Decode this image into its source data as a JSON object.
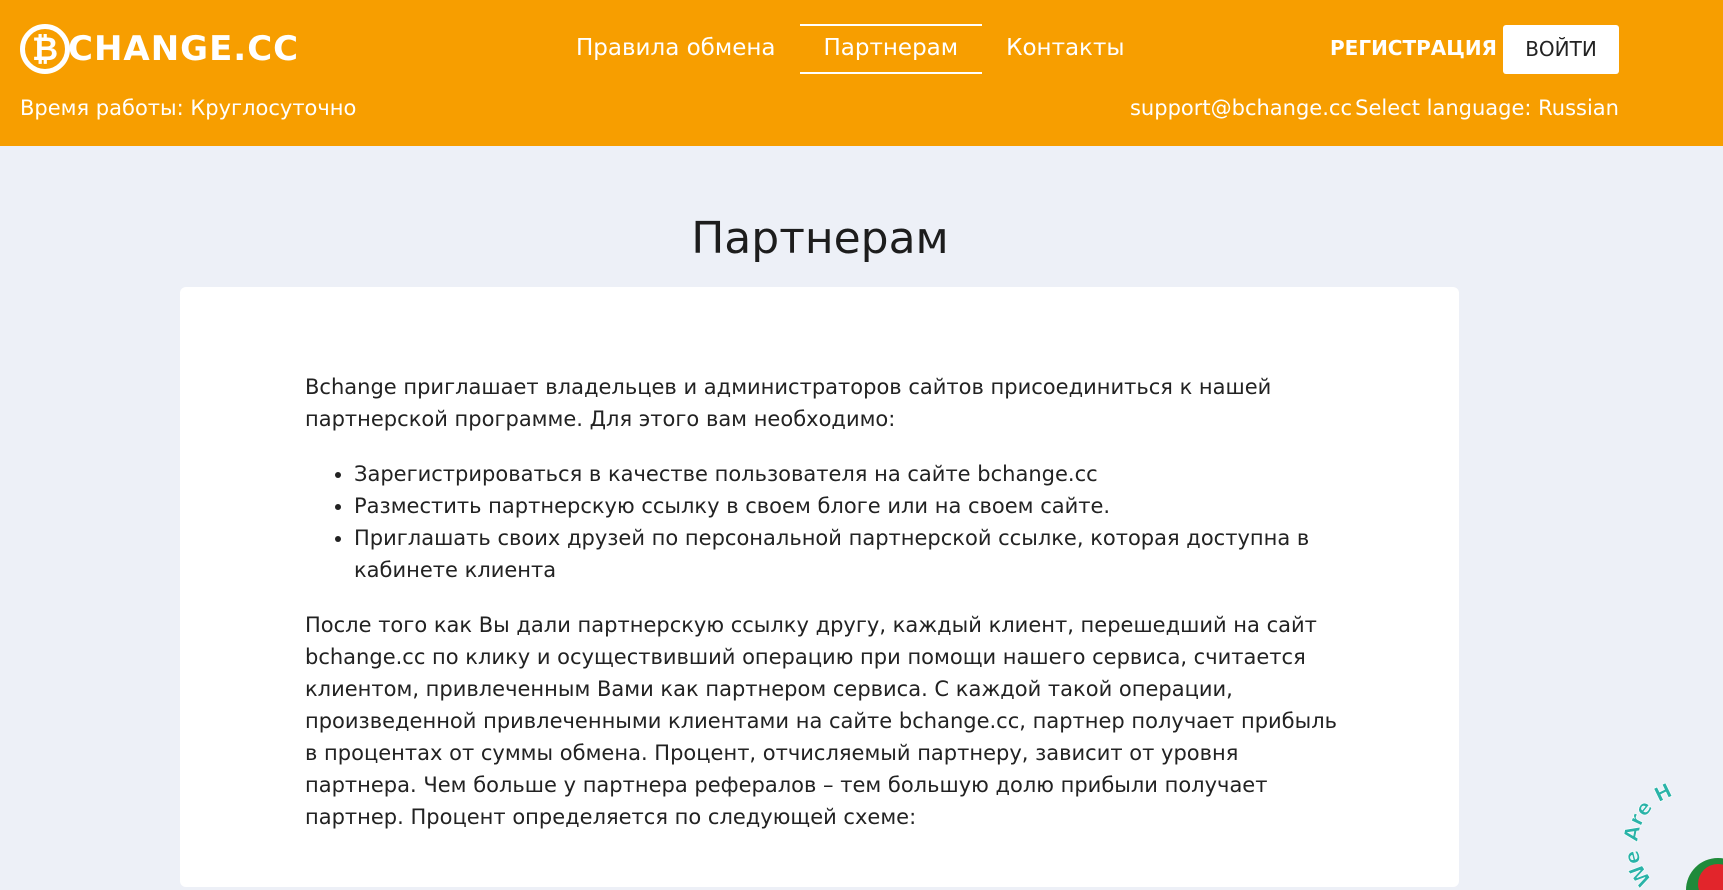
{
  "header": {
    "logo_coin": "₿",
    "logo_text": "CHANGE.CC",
    "nav": [
      {
        "label": "Правила обмена",
        "active": false
      },
      {
        "label": "Партнерам",
        "active": true
      },
      {
        "label": "Контакты",
        "active": false
      }
    ],
    "register_label": "РЕГИСТРАЦИЯ",
    "login_label": "ВОЙТИ",
    "worktime": "Время работы: Круглосуточно",
    "support_email": "support@bchange.cc",
    "language": "Select language: Russian"
  },
  "page": {
    "title": "Партнерам",
    "intro": "Bchange приглашает владельцев и администраторов сайтов присоединиться к нашей партнерской программе. Для этого вам необходимо:",
    "steps": [
      "Зарегистрироваться в качестве пользователя на сайте bchange.cc",
      "Разместить партнерскую ссылку в своем блоге или на своем сайте.",
      "Приглашать своих друзей по персональной партнерской ссылке, которая доступна в кабинете клиента"
    ],
    "details": "После того как Вы дали партнерскую ссылку другу, каждый клиент, перешедший на сайт bchange.cc по клику и осуществивший операцию при помощи нашего сервиса, считается клиентом, привлеченным Вами как партнером сервиса. С каждой такой операции, произведенной привлеченными клиентами на сайте bchange.cc, партнер получает прибыль в процентах от суммы обмена. Процент, отчисляемый партнеру, зависит от уровня партнера. Чем больше у партнера рефералов – тем большую долю прибыли получает партнер. Процент определяется по следующей схеме:"
  },
  "badge": {
    "text": "We Are H"
  },
  "colors": {
    "header_bg": "#f79e00",
    "page_bg": "#edf0f7",
    "card_bg": "#ffffff"
  }
}
